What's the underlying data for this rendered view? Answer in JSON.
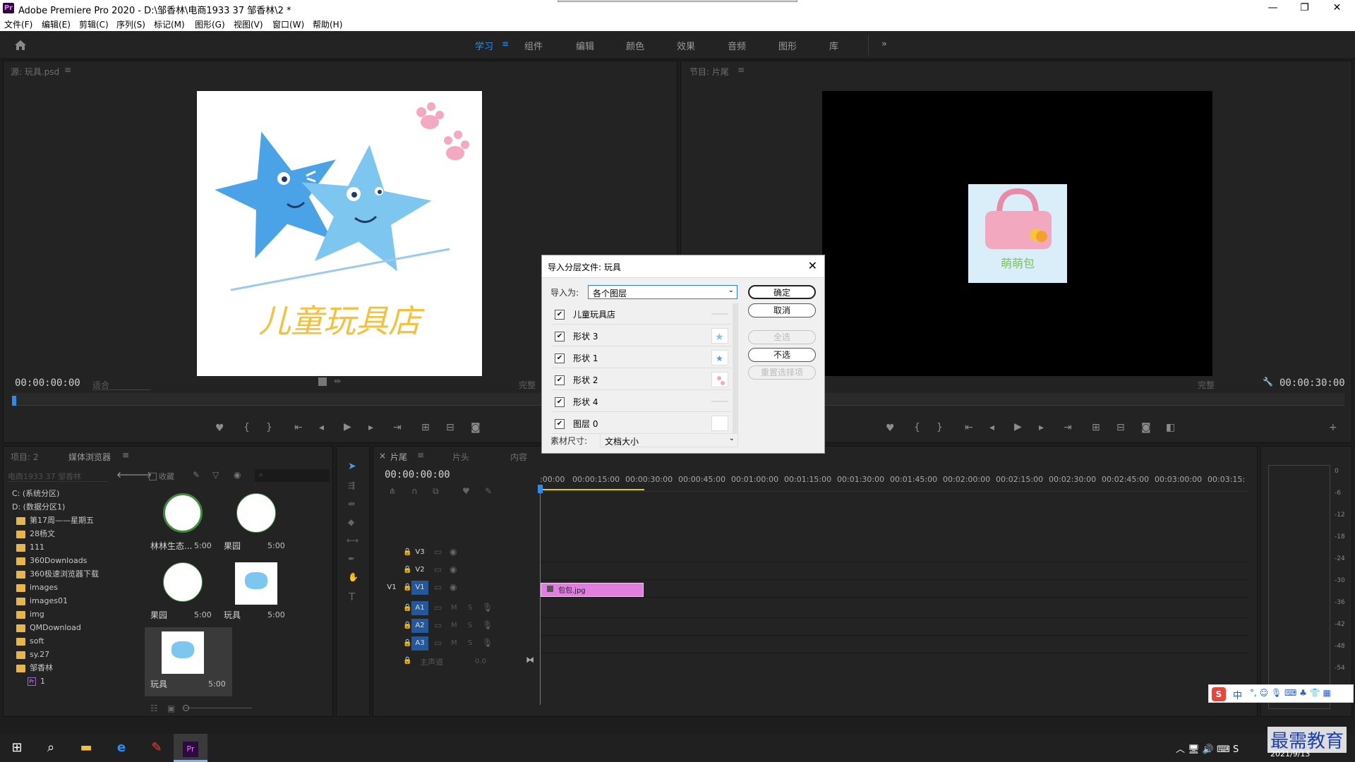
{
  "window": {
    "title": "Adobe Premiere Pro 2020 - D:\\邹香林\\电商1933 37 邹香林\\2 *",
    "app_icon": "Pr",
    "minimize": "—",
    "restore": "❐",
    "close": "✕"
  },
  "menu": [
    "文件(F)",
    "编辑(E)",
    "剪辑(C)",
    "序列(S)",
    "标记(M)",
    "图形(G)",
    "视图(V)",
    "窗口(W)",
    "帮助(H)"
  ],
  "workspaces": {
    "items": [
      "学习",
      "组件",
      "编辑",
      "颜色",
      "效果",
      "音频",
      "图形",
      "库"
    ],
    "active": "学习",
    "more": "»"
  },
  "source": {
    "title": "源: 玩具.psd",
    "timecode": "00:00:00:00",
    "fit": "适合",
    "quality": "完整",
    "shop_text": "儿童玩具店"
  },
  "program": {
    "title": "节目: 片尾",
    "timecode": "00:00:30:00",
    "quality": "完整",
    "bag_text": "萌萌包"
  },
  "project": {
    "tab1": "项目: 2",
    "tab2": "媒体浏览器",
    "path_dropdown": "电商1933 37 邹香林",
    "favorites": "收藏",
    "tree": [
      {
        "label": "C: (系统分区)",
        "type": "drive",
        "indent": 0
      },
      {
        "label": "D: (数据分区1)",
        "type": "drive",
        "indent": 0
      },
      {
        "label": "第17周——星期五",
        "type": "folder",
        "indent": 1
      },
      {
        "label": "28杨文",
        "type": "folder",
        "indent": 1
      },
      {
        "label": "111",
        "type": "folder",
        "indent": 1
      },
      {
        "label": "360Downloads",
        "type": "folder",
        "indent": 1
      },
      {
        "label": "360极速浏览器下载",
        "type": "folder",
        "indent": 1
      },
      {
        "label": "images",
        "type": "folder",
        "indent": 1
      },
      {
        "label": "images01",
        "type": "folder",
        "indent": 1
      },
      {
        "label": "img",
        "type": "folder",
        "indent": 1
      },
      {
        "label": "QMDownload",
        "type": "folder",
        "indent": 1
      },
      {
        "label": "soft",
        "type": "folder",
        "indent": 1
      },
      {
        "label": "sy.27",
        "type": "folder",
        "indent": 1
      },
      {
        "label": "邹香林",
        "type": "folder",
        "indent": 1
      },
      {
        "label": "1",
        "type": "pr",
        "indent": 2
      }
    ],
    "thumbs": [
      {
        "name": "林林生态...",
        "duration": "5:00"
      },
      {
        "name": "果园",
        "duration": "5:00"
      },
      {
        "name": "果园",
        "duration": "5:00"
      },
      {
        "name": "玩具",
        "duration": "5:00"
      },
      {
        "name": "玩具",
        "duration": "5:00"
      }
    ]
  },
  "timeline": {
    "tab_close": "×",
    "tab1": "片尾",
    "tab2": "片头",
    "tab3": "内容",
    "timecode": "00:00:00:00",
    "ticks": [
      ":00:00",
      "00:00:15:00",
      "00:00:30:00",
      "00:00:45:00",
      "00:01:00:00",
      "00:01:15:00",
      "00:01:30:00",
      "00:01:45:00",
      "00:02:00:00",
      "00:02:15:00",
      "00:02:30:00",
      "00:02:45:00",
      "00:03:00:00",
      "00:03:15:"
    ],
    "tracks": [
      "V3",
      "V2",
      "V1",
      "A1",
      "A2",
      "A3"
    ],
    "source_v1": "V1",
    "clip_name": "包包.jpg",
    "master": "主声道",
    "master_value": "0.0",
    "audio_m": "M",
    "audio_s": "S"
  },
  "meter": {
    "labels": [
      "0",
      "-6",
      "-12",
      "-18",
      "-24",
      "-30",
      "-36",
      "-42",
      "-48",
      "-54"
    ]
  },
  "dialog": {
    "title": "导入分层文件: 玩具",
    "import_as_label": "导入为:",
    "import_as_value": "各个图层",
    "footage_label": "素材尺寸:",
    "footage_value": "文档大小",
    "ok": "确定",
    "cancel": "取消",
    "select_all": "全选",
    "select_none": "不选",
    "reset": "重置选择项",
    "layers": [
      "儿童玩具店",
      "形状 3",
      "形状 1",
      "形状 2",
      "形状 4",
      "图层 0"
    ]
  },
  "taskbar": {
    "date": "2021/9/13",
    "ime": "中",
    "watermark": "最需教育"
  }
}
